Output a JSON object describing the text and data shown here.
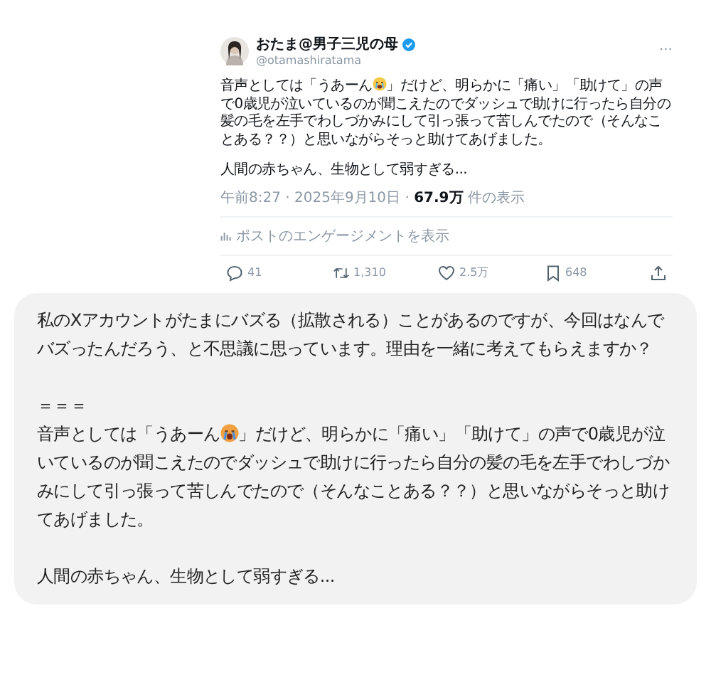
{
  "post": {
    "author": {
      "name": "おたま@男子三児の母",
      "verified": true,
      "handle": "@otamashiratama"
    },
    "more": "···",
    "body": {
      "before_emoji": "音声としては「うあーん",
      "after_emoji": "」だけど、明らかに「痛い」「助けて」の声で0歳児が泣いているのが聞こえたのでダッシュで助けに行ったら自分の髪の毛を左手でわしづかみにして引っ張って苦しんでたので（そんなことある？？）と思いながらそっと助けてあげました。"
    },
    "closing": "人間の赤ちゃん、生物として弱すぎる...",
    "meta": {
      "time": "午前8:27 · 2025年9月10日 · ",
      "views": "67.9万",
      "views_label": " 件の表示"
    },
    "engagement": "ポストのエンゲージメントを表示",
    "actions": [
      {
        "kind": "reply",
        "count": "41"
      },
      {
        "kind": "repost",
        "count": "1,310"
      },
      {
        "kind": "like",
        "count": "2.5万"
      },
      {
        "kind": "bookmark",
        "count": "648"
      },
      {
        "kind": "share"
      }
    ]
  },
  "message": {
    "question": "私のXアカウントがたまにバズる（拡散される）ことがあるのですが、今回はなんでバズったんだろう、と不思議に思っています。理由を一緒に考えてもらえますか？",
    "separator": "＝＝＝",
    "quote_before_emoji": "音声としては「うあーん",
    "quote_after_emoji": "」だけど、明らかに「痛い」「助けて」の声で0歳児が泣いているのが聞こえたのでダッシュで助けに行ったら自分の髪の毛を左手でわしづかみにして引っ張って苦しんでたので（そんなことある？？）と思いながらそっと助けてあげました。",
    "closing": "人間の赤ちゃん、生物として弱すぎる..."
  }
}
